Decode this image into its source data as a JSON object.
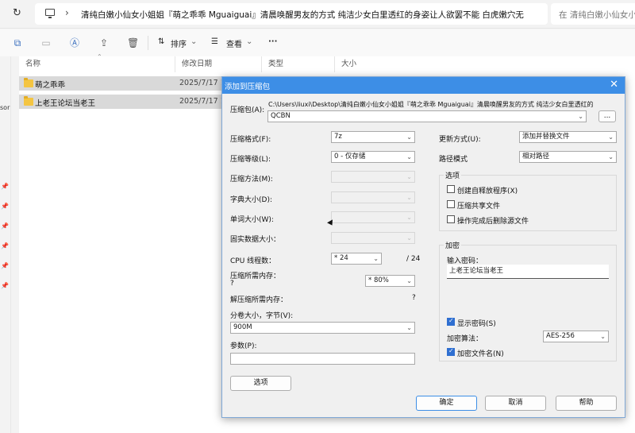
{
  "explorer": {
    "address_path": "清纯白嫩小仙女小姐姐『萌之乖乖 Mguaiguai』清晨唤醒男友的方式 纯洁少女白里透红的身姿让人欲罢不能 白虎嫩穴无",
    "search_placeholder": "在 清纯白嫩小仙女小",
    "toolbar": {
      "sort_label": "排序",
      "view_label": "查看",
      "more_label": "···"
    },
    "columns": {
      "name": "名称",
      "date": "修改日期",
      "type": "类型",
      "size": "大小"
    },
    "rows": [
      {
        "name": "萌之乖乖",
        "date": "2025/7/17 1"
      },
      {
        "name": "上老王论坛当老王",
        "date": "2025/7/17 1"
      }
    ],
    "left_partial_text": "sor"
  },
  "dialog": {
    "title": "添加到压缩包",
    "archive_label": "压缩包(A):",
    "archive_dir": "C:\\Users\\liuxi\\Desktop\\清纯白嫩小仙女小姐姐『萌之乖乖 Mguaiguai』清晨唤醒男友的方式 纯洁少女白里透红的",
    "archive_name": "QCBN",
    "browse_label": "...",
    "format_label": "压缩格式(F):",
    "format_value": "7z",
    "level_label": "压缩等级(L):",
    "level_value": "0 - 仅存储",
    "method_label": "压缩方法(M):",
    "dict_label": "字典大小(D):",
    "word_label": "单词大小(W):",
    "solid_label": "固实数据大小：",
    "threads_label": "CPU 线程数：",
    "threads_value": "* 24",
    "threads_total": "/ 24",
    "mem_compress_label": "压缩所需内存：",
    "mem_compress_q": "?",
    "mem_compress_value": "* 80%",
    "mem_decompress_label": "解压缩所需内存：",
    "mem_decompress_value": "?",
    "volume_label": "分卷大小，字节(V):",
    "volume_value": "900M",
    "params_label": "参数(P):",
    "params_value": "",
    "options_button": "选项",
    "update_label": "更新方式(U):",
    "update_value": "添加并替换文件",
    "pathmode_label": "路径模式",
    "pathmode_value": "相对路径",
    "options_group": "选项",
    "opt_sfx": "创建自释放程序(X)",
    "opt_shared": "压缩共享文件",
    "opt_delete": "操作完成后删除源文件",
    "encrypt_group": "加密",
    "password_label": "输入密码：",
    "password_value": "上老王论坛当老王",
    "show_password": "显示密码(S)",
    "enc_method_label": "加密算法：",
    "enc_method_value": "AES-256",
    "encrypt_names": "加密文件名(N)",
    "ok": "确定",
    "cancel": "取消",
    "help": "帮助"
  }
}
